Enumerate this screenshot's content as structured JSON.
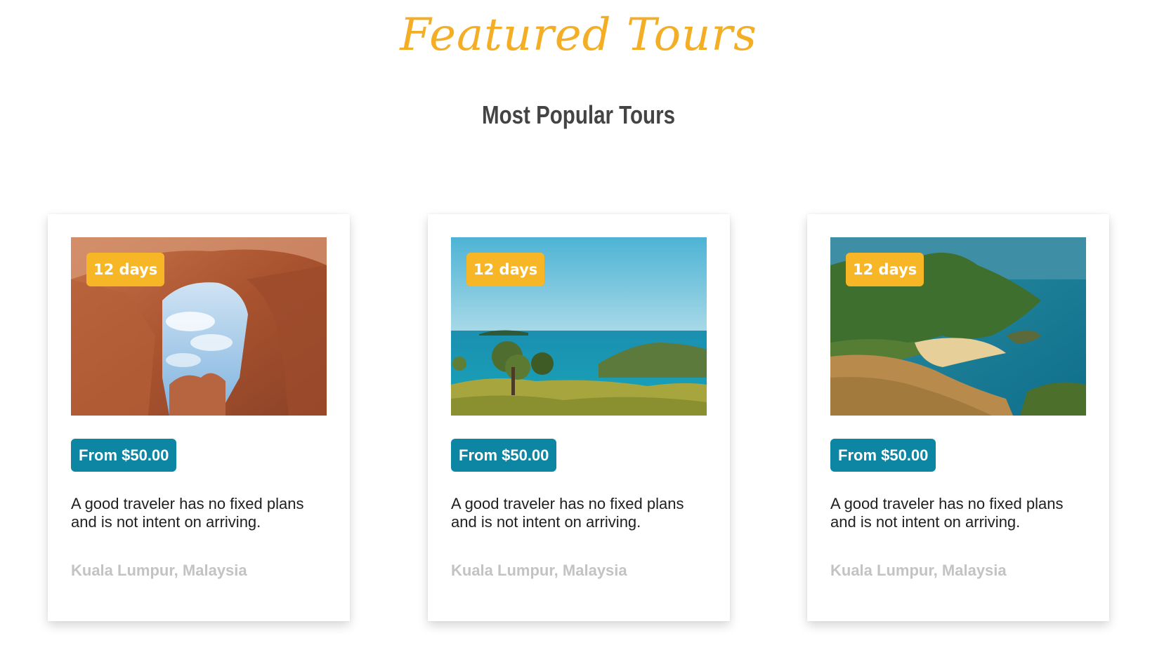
{
  "header": {
    "script_title": "Featured Tours",
    "subtitle": "Most Popular Tours",
    "accent_color": "#f4ae25"
  },
  "tours": [
    {
      "image": "desert-rock-arch-photo",
      "duration": "12 days",
      "price": "From $50.00",
      "description": "A good traveler has no fixed plans and is not intent on arriving.",
      "location": "Kuala Lumpur, Malaysia"
    },
    {
      "image": "tropical-sea-coast-photo",
      "duration": "12 days",
      "price": "From $50.00",
      "description": "A good traveler has no fixed plans and is not intent on arriving.",
      "location": "Kuala Lumpur, Malaysia"
    },
    {
      "image": "island-beach-bay-photo",
      "duration": "12 days",
      "price": "From $50.00",
      "description": "A good traveler has no fixed plans and is not intent on arriving.",
      "location": "Kuala Lumpur, Malaysia"
    }
  ],
  "colors": {
    "duration_badge": "#f6b626",
    "price_badge": "#0d86a4",
    "location_text": "#c3c3c3"
  }
}
